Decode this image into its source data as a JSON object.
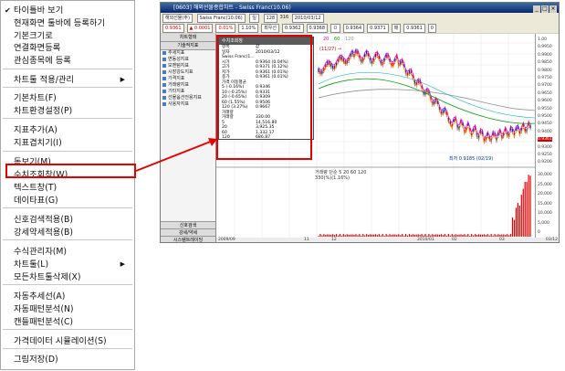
{
  "menu": {
    "items": [
      {
        "label": "타이틀바 보기",
        "checked": true
      },
      {
        "label": "현재화면 툴바에 등록하기"
      },
      {
        "label": "기본크기로"
      },
      {
        "label": "연결화면등록"
      },
      {
        "label": "관심종목에 등록"
      },
      {
        "label": "차트툴 적용/관리",
        "submenu": true
      },
      {
        "label": "기본차트(F)"
      },
      {
        "label": "차트환경설정(P)"
      },
      {
        "label": "지표추가(A)"
      },
      {
        "label": "지표겹치기(I)"
      },
      {
        "label": "돋보기(M)"
      },
      {
        "label": "수치조회창(W)"
      },
      {
        "label": "텍스트창(T)"
      },
      {
        "label": "데이타표(G)"
      },
      {
        "label": "신호검색적용(B)"
      },
      {
        "label": "강세약세적용(B)"
      },
      {
        "label": "수식관리자(M)"
      },
      {
        "label": "차트툴(L)",
        "submenu": true
      },
      {
        "label": "모든차트툴삭제(X)"
      },
      {
        "label": "자동추세선(A)"
      },
      {
        "label": "자동패턴분석(N)"
      },
      {
        "label": "캔들패턴분석(C)"
      },
      {
        "label": "가격데이터 시뮬레이션(S)"
      },
      {
        "label": "그림저장(D)"
      }
    ]
  },
  "window": {
    "title": "[0603] 해외선물종합차트 - Swiss Franc(10.06)",
    "toolbar1": {
      "symbol_code": "해외선물(주)",
      "period": "일",
      "count": "128",
      "of": "316",
      "date": "2010/03/12",
      "product": "Swiss Franc(10.06)"
    },
    "toolbar2": {
      "values": [
        "0.9361",
        "▲ 0.0001",
        "0.01%",
        "1.10%",
        "최우선",
        "0.9362",
        "0.9368",
        "ㅁ",
        "0.9364",
        "0.9371",
        "매",
        "0.9361",
        "0"
      ]
    },
    "left_panel": {
      "header": "차트형태",
      "sub": "기술적지표",
      "items": [
        "추세지표",
        "변동성지표",
        "모멘텀지표",
        "시장강도지표",
        "가격지표",
        "거래량지표",
        "기타지표",
        "선물옵션전용지표",
        "사용자지표"
      ],
      "bottom": [
        "신호검색",
        "강세/약세",
        "시스템트레이딩"
      ]
    },
    "value_window": {
      "title": "수치조회창",
      "rows": [
        {
          "k": "항목",
          "v": "값"
        },
        {
          "k": "일자",
          "v": "2010/03/12"
        },
        {
          "k": "Swiss Franc(1...",
          "v": ""
        },
        {
          "k": "시가",
          "v": "0.9364 (0.04%)"
        },
        {
          "k": "고가",
          "v": "0.9371 (0.12%)"
        },
        {
          "k": "저가",
          "v": "0.9361 (0.01%)"
        },
        {
          "k": "종가",
          "v": "0.9361 (0.01%)"
        },
        {
          "k": "가격 이동평균",
          "v": ""
        },
        {
          "k": "5 (-0.16%)",
          "v": "0.9346"
        },
        {
          "k": "10 (-0.25%)",
          "v": "0.9331"
        },
        {
          "k": "20 (-0.65%)",
          "v": "0.9309"
        },
        {
          "k": "60 (1.55%)",
          "v": "0.9506"
        },
        {
          "k": "120 (3.27%)",
          "v": "0.9667"
        },
        {
          "k": "거래량",
          "v": ""
        },
        {
          "k": "거래량",
          "v": "330.00"
        },
        {
          "k": "5",
          "v": "14,516.80"
        },
        {
          "k": "20",
          "v": "3,925.35"
        },
        {
          "k": "60",
          "v": "1,332.17"
        },
        {
          "k": "120",
          "v": "686.87"
        }
      ]
    },
    "chart_labels": {
      "high_label": "(11/27) →",
      "low_label": "최저 0.9185 (02/19)",
      "ma_legend": [
        "20",
        "60",
        "120"
      ],
      "volume_legend": "거래량 단순 5 20 60 120",
      "volume_value": "330(%)(1.16%)",
      "date_axis": [
        "2009/09",
        "11",
        "12",
        "2010/01",
        "02",
        "03"
      ],
      "last_date": "03/12"
    },
    "price_axis": [
      "1.00",
      "0.9950",
      "0.9900",
      "0.9850",
      "0.9800",
      "0.9750",
      "0.9700",
      "0.9650",
      "0.9600",
      "0.9550",
      "0.9500",
      "0.9450",
      "0.9400",
      "0.9361",
      "0.9300",
      "0.9250",
      "0.9200"
    ],
    "volume_axis": [
      "30,000",
      "25,000",
      "20,000",
      "15,000",
      "10,000",
      "5,000",
      "0"
    ]
  },
  "colors": {
    "highlight": "#e60000",
    "candle_up": "#e00000",
    "candle_down": "#0030c0"
  }
}
